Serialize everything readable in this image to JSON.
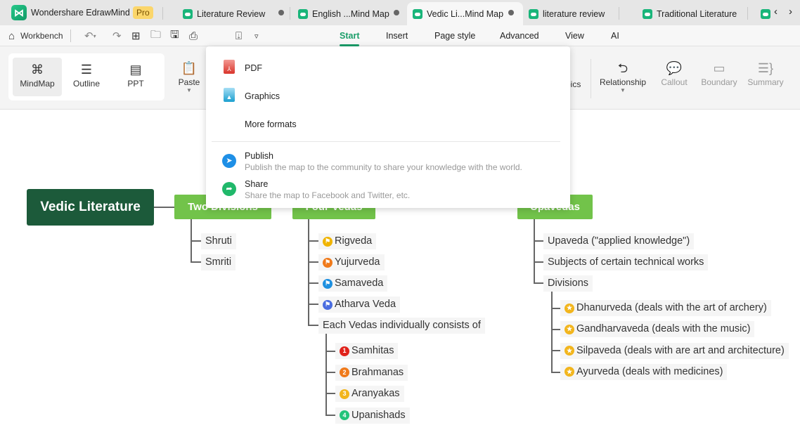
{
  "app": {
    "name": "Wondershare EdrawMind",
    "badge": "Pro",
    "brand_color": "#19b57a"
  },
  "tabs": [
    {
      "label": "Literature Review",
      "modified": true
    },
    {
      "label": "English ...Mind Map",
      "modified": true
    },
    {
      "label": "Vedic Li...Mind Map",
      "modified": true,
      "active": true
    },
    {
      "label": "literature review"
    },
    {
      "label": "Traditional Literature"
    }
  ],
  "toolbar": {
    "workbench": "Workbench",
    "menus": [
      "Start",
      "Insert",
      "Page style",
      "Advanced",
      "View",
      "AI"
    ],
    "active_menu": "Start"
  },
  "ribbon": {
    "views": [
      "MindMap",
      "Outline",
      "PPT"
    ],
    "paste": "Paste",
    "topics_partial": "pics",
    "relationship": "Relationship",
    "callout": "Callout",
    "boundary": "Boundary",
    "summary": "Summary"
  },
  "export_menu": {
    "items": [
      {
        "label": "PDF",
        "icon": "pdf-icon"
      },
      {
        "label": "Graphics",
        "icon": "image-icon"
      },
      {
        "label": "More formats"
      }
    ],
    "actions": [
      {
        "label": "Publish",
        "desc": "Publish the map to the community to share your knowledge with the world.",
        "icon": "paper-plane-icon",
        "color": "#1e8fe6"
      },
      {
        "label": "Share",
        "desc": "Share the map to Facebook and Twitter, etc.",
        "icon": "share-arrow-icon",
        "color": "#20b86a"
      }
    ]
  },
  "mindmap": {
    "root": "Vedic Literature",
    "two_divisions": {
      "title": "Two Divisions",
      "children": [
        "Shruti",
        "Smriti"
      ]
    },
    "four_vedas": {
      "title": "Four Vedas",
      "children": [
        {
          "label": "Rigveda",
          "flag": "#f0b400"
        },
        {
          "label": "Yujurveda",
          "flag": "#f07a1a"
        },
        {
          "label": "Samaveda",
          "flag": "#1e90e0"
        },
        {
          "label": "Atharva Veda",
          "flag": "#4a6de0"
        }
      ],
      "consists": {
        "label": "Each Vedas individually consists of",
        "children": [
          {
            "label": "Samhitas",
            "num": "1",
            "color": "#e0231c"
          },
          {
            "label": "Brahmanas",
            "num": "2",
            "color": "#f07a1a"
          },
          {
            "label": "Aranyakas",
            "num": "3",
            "color": "#f2b51c"
          },
          {
            "label": "Upanishads",
            "num": "4",
            "color": "#22c47a"
          }
        ]
      }
    },
    "upavedas": {
      "title": "Upavedas",
      "children": [
        "Upaveda (\"applied knowledge\")",
        "Subjects of certain technical works",
        "Divisions"
      ],
      "divisions": [
        "Dhanurveda (deals with the art of archery)",
        "Gandharvaveda (deals with the music)",
        "Silpaveda (deals with are art and architecture)",
        "Ayurveda (deals with medicines)"
      ]
    }
  }
}
